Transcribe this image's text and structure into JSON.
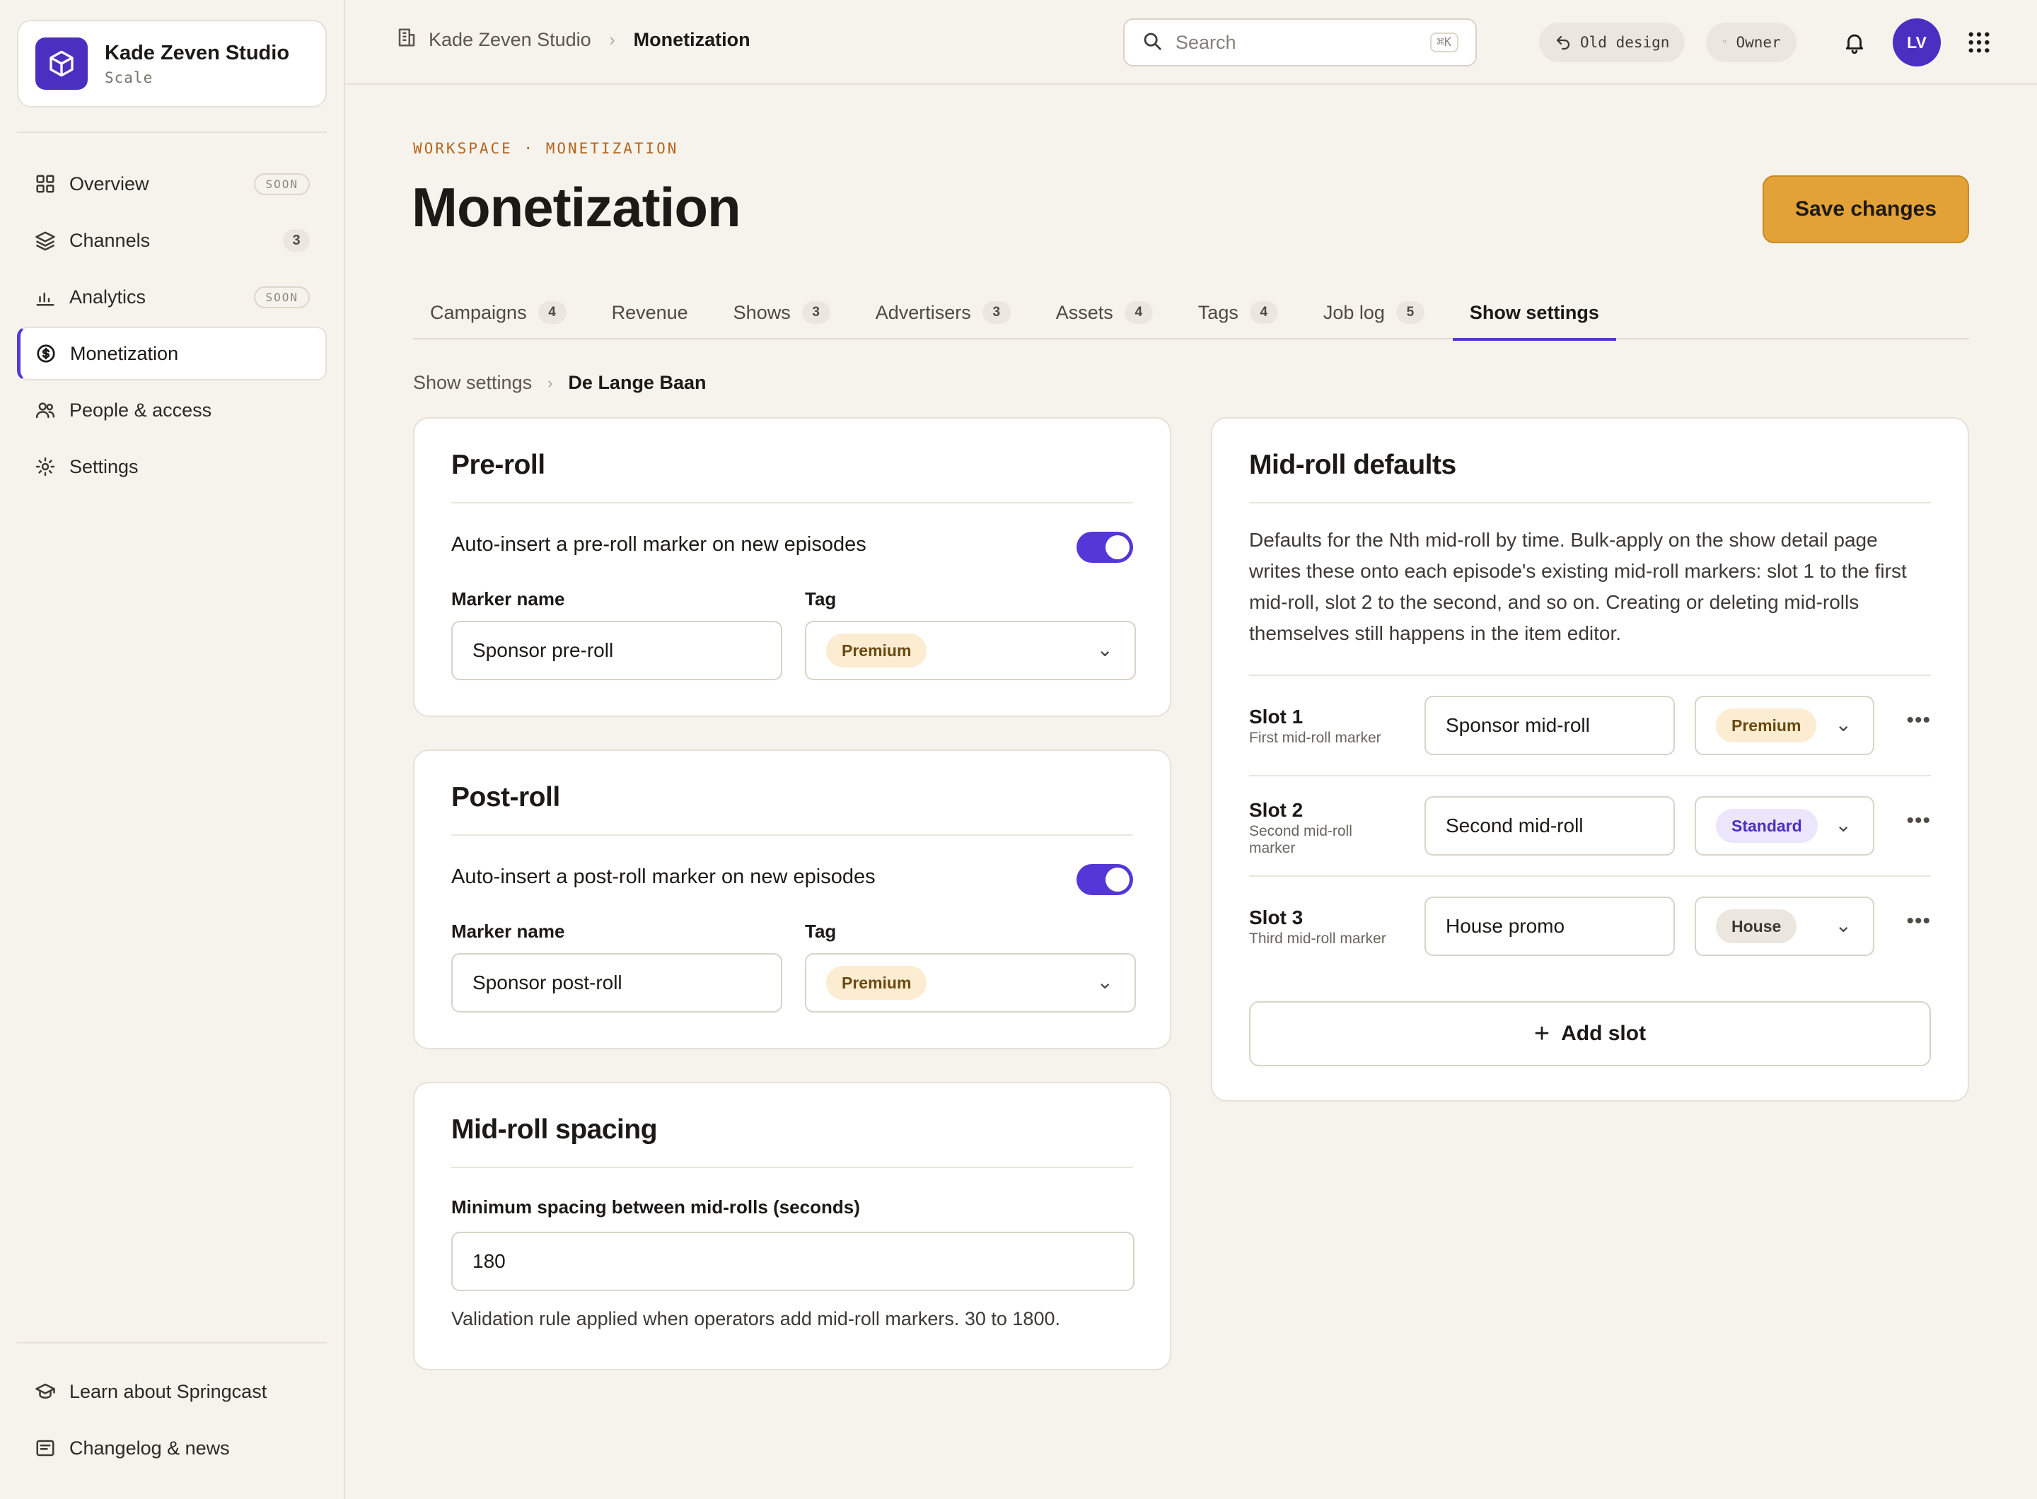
{
  "workspace": {
    "name": "Kade Zeven Studio",
    "plan": "Scale"
  },
  "sidebar": {
    "items": [
      {
        "label": "Overview",
        "badge": "SOON"
      },
      {
        "label": "Channels",
        "badge": "3"
      },
      {
        "label": "Analytics",
        "badge": "SOON"
      },
      {
        "label": "Monetization",
        "badge": ""
      },
      {
        "label": "People & access",
        "badge": ""
      },
      {
        "label": "Settings",
        "badge": ""
      }
    ],
    "bottom": [
      {
        "label": "Learn about Springcast"
      },
      {
        "label": "Changelog & news"
      }
    ]
  },
  "topbar": {
    "breadcrumb": [
      "Kade Zeven Studio",
      "Monetization"
    ],
    "search": {
      "placeholder": "Search",
      "shortcut": "⌘K"
    },
    "old_design": "Old design",
    "role": "Owner",
    "avatar_initials": "LV"
  },
  "page": {
    "eyebrow": "WORKSPACE · MONETIZATION",
    "title": "Monetization",
    "save_label": "Save changes"
  },
  "tabs": [
    {
      "label": "Campaigns",
      "count": "4"
    },
    {
      "label": "Revenue",
      "count": ""
    },
    {
      "label": "Shows",
      "count": "3"
    },
    {
      "label": "Advertisers",
      "count": "3"
    },
    {
      "label": "Assets",
      "count": "4"
    },
    {
      "label": "Tags",
      "count": "4"
    },
    {
      "label": "Job log",
      "count": "5"
    },
    {
      "label": "Show settings",
      "count": ""
    }
  ],
  "subcrumb": [
    "Show settings",
    "De Lange Baan"
  ],
  "preroll": {
    "title": "Pre-roll",
    "toggle_label": "Auto-insert a pre-roll marker on new episodes",
    "toggle_on": true,
    "marker_label": "Marker name",
    "marker_value": "Sponsor pre-roll",
    "tag_label": "Tag",
    "tag_value": "Premium"
  },
  "postroll": {
    "title": "Post-roll",
    "toggle_label": "Auto-insert a post-roll marker on new episodes",
    "toggle_on": true,
    "marker_label": "Marker name",
    "marker_value": "Sponsor post-roll",
    "tag_label": "Tag",
    "tag_value": "Premium"
  },
  "spacing": {
    "title": "Mid-roll spacing",
    "label": "Minimum spacing between mid-rolls (seconds)",
    "value": "180",
    "help": "Validation rule applied when operators add mid-roll markers. 30 to 1800."
  },
  "midroll": {
    "title": "Mid-roll defaults",
    "description": "Defaults for the Nth mid-roll by time. Bulk-apply on the show detail page writes these onto each episode's existing mid-roll markers: slot 1 to the first mid-roll, slot 2 to the second, and so on. Creating or deleting mid-rolls themselves still happens in the item editor.",
    "slots": [
      {
        "title": "Slot 1",
        "subtitle": "First mid-roll marker",
        "marker": "Sponsor mid-roll",
        "tag": "Premium"
      },
      {
        "title": "Slot 2",
        "subtitle": "Second mid-roll marker",
        "marker": "Second mid-roll",
        "tag": "Standard"
      },
      {
        "title": "Slot 3",
        "subtitle": "Third mid-roll marker",
        "marker": "House promo",
        "tag": "House"
      }
    ],
    "add_label": "Add slot"
  },
  "colors": {
    "accent": "#5437d6",
    "brand": "#4a2fc1",
    "save": "#e3a237",
    "eyebrow": "#b5651d"
  }
}
